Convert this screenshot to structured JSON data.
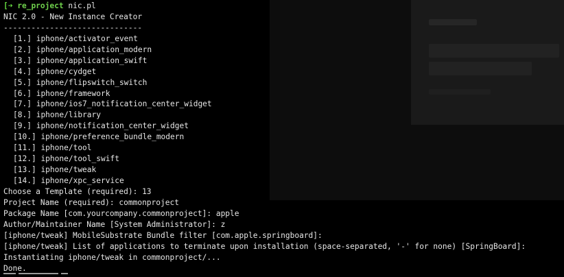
{
  "prompt": {
    "arrow": "[➜",
    "directory": "re_project",
    "command": "nic.pl"
  },
  "header": {
    "title": "NIC 2.0 - New Instance Creator",
    "separator": "------------------------------"
  },
  "templates": [
    {
      "index": "[1.]",
      "name": "iphone/activator_event"
    },
    {
      "index": "[2.]",
      "name": "iphone/application_modern"
    },
    {
      "index": "[3.]",
      "name": "iphone/application_swift"
    },
    {
      "index": "[4.]",
      "name": "iphone/cydget"
    },
    {
      "index": "[5.]",
      "name": "iphone/flipswitch_switch"
    },
    {
      "index": "[6.]",
      "name": "iphone/framework"
    },
    {
      "index": "[7.]",
      "name": "iphone/ios7_notification_center_widget"
    },
    {
      "index": "[8.]",
      "name": "iphone/library"
    },
    {
      "index": "[9.]",
      "name": "iphone/notification_center_widget"
    },
    {
      "index": "[10.]",
      "name": "iphone/preference_bundle_modern"
    },
    {
      "index": "[11.]",
      "name": "iphone/tool"
    },
    {
      "index": "[12.]",
      "name": "iphone/tool_swift"
    },
    {
      "index": "[13.]",
      "name": "iphone/tweak"
    },
    {
      "index": "[14.]",
      "name": "iphone/xpc_service"
    }
  ],
  "output": [
    "Choose a Template (required): 13",
    "Project Name (required): commonproject",
    "Package Name [com.yourcompany.commonproject]: apple",
    "Author/Maintainer Name [System Administrator]: z",
    "[iphone/tweak] MobileSubstrate Bundle filter [com.apple.springboard]:",
    "[iphone/tweak] List of applications to terminate upon installation (space-separated, '-' for none) [SpringBoard]:",
    "Instantiating iphone/tweak in commonproject/...",
    "Done."
  ]
}
